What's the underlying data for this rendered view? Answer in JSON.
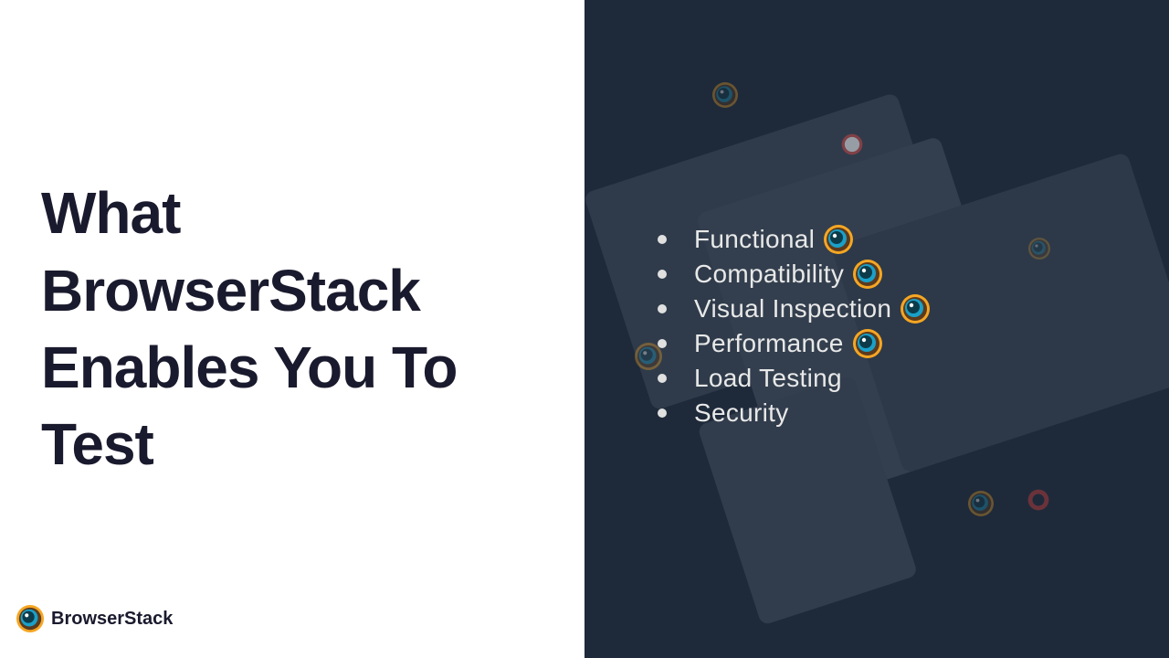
{
  "heading": "What BrowserStack Enables You To Test",
  "brand": "BrowserStack",
  "items": [
    {
      "label": "Functional",
      "icon": true
    },
    {
      "label": "Compatibility",
      "icon": true
    },
    {
      "label": "Visual Inspection",
      "icon": true
    },
    {
      "label": "Performance",
      "icon": true
    },
    {
      "label": "Load Testing",
      "icon": false
    },
    {
      "label": "Security",
      "icon": false
    }
  ]
}
